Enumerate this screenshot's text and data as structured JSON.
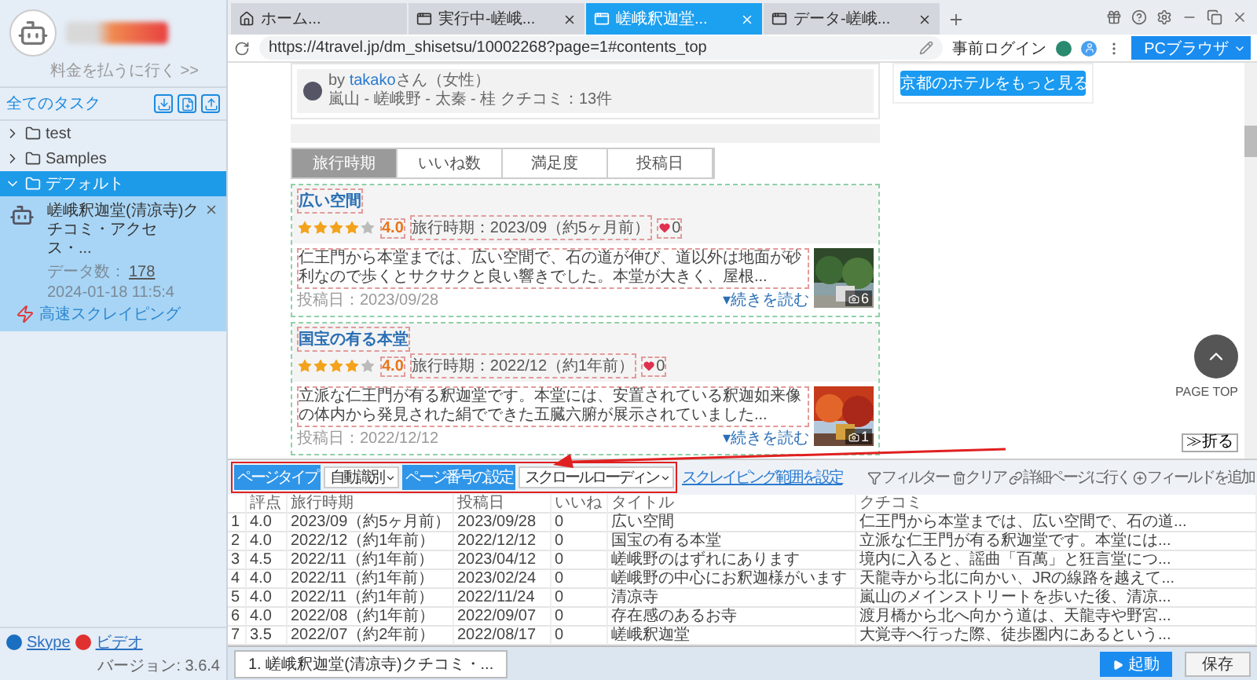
{
  "sidebar": {
    "upgrade_link": "料金を払うに行く >>",
    "section_title": "全てのタスク",
    "folders": [
      {
        "name": "test",
        "expanded": false,
        "selected": false
      },
      {
        "name": "Samples",
        "expanded": false,
        "selected": false
      },
      {
        "name": "デフォルト",
        "expanded": true,
        "selected": true,
        "children": [
          {
            "title": "嵯峨釈迦堂(清凉寺)クチコミ・アクセス・...",
            "count_label": "データ数：",
            "count": "178",
            "time": "2024-01-18 11:5:4",
            "mode": "高速スクレイピング",
            "selected": true
          }
        ]
      }
    ],
    "footer": {
      "links": [
        "Skype",
        "ビデオ"
      ],
      "version": "バージョン: 3.6.4"
    }
  },
  "browser_tabs": [
    {
      "label": "ホーム...",
      "kind": "home",
      "selected": false,
      "closable": false
    },
    {
      "label": "実行中-嵯峨...",
      "kind": "page",
      "selected": false,
      "closable": true
    },
    {
      "label": "嵯峨釈迦堂...",
      "kind": "page",
      "selected": true,
      "closable": true
    },
    {
      "label": "データ-嵯峨...",
      "kind": "page",
      "selected": false,
      "closable": true
    }
  ],
  "address_bar": {
    "url": "https://4travel.jp/dm_shisetsu/10002268?page=1#contents_top",
    "login": "事前ログイン",
    "mode_button": "PCブラウザ"
  },
  "web_page": {
    "author": {
      "by": "by ",
      "name": "takako",
      "suffix": "さん（女性）",
      "meta": "嵐山 - 嵯峨野 - 太秦 - 桂 クチコミ：13件"
    },
    "hotel_button": "京都のホテルをもっと見る",
    "sort_tabs": [
      {
        "label": "旅行時期",
        "selected": true
      },
      {
        "label": "いいね数",
        "selected": false
      },
      {
        "label": "満足度",
        "selected": false
      },
      {
        "label": "投稿日",
        "selected": false
      }
    ],
    "reviews": [
      {
        "title": "広い空間",
        "stars": 4,
        "score": "4.0",
        "period": "旅行時期：2023/09（約5ヶ月前）",
        "likes": "0",
        "text": "仁王門から本堂までは、広い空間で、石の道が伸び、道以外は地面が砂利なので歩くとサクサクと良い響きでした。本堂が大きく、屋根...",
        "more": "▾続きを読む",
        "posted": "投稿日：2023/09/28",
        "photos": "6"
      },
      {
        "title": "国宝の有る本堂",
        "stars": 4,
        "score": "4.0",
        "period": "旅行時期：2022/12（約1年前）",
        "likes": "0",
        "text": "立派な仁王門が有る釈迦堂です。本堂には、安置されている釈迦如来像の体内から発見された絹でできた五臓六腑が展示されていました...",
        "more": "▾続きを読む",
        "posted": "投稿日：2022/12/12",
        "photos": "1"
      }
    ],
    "page_top": "PAGE TOP",
    "fold_button": "≫折る"
  },
  "toolbar": {
    "page_type_label": "ページタイプ",
    "page_type_value": "自動識別",
    "page_number_label": "ページ番号の設定",
    "page_number_value": "スクロールローディン",
    "range_link": "スクレイピング範囲を設定",
    "actions": [
      {
        "label": "フィルター",
        "kind": "filter"
      },
      {
        "label": "クリア",
        "kind": "clear"
      },
      {
        "label": "詳細ページに行く",
        "kind": "link"
      },
      {
        "label": "フィールドを追加",
        "kind": "add"
      }
    ]
  },
  "table": {
    "columns": [
      "",
      "評点",
      "旅行時期",
      "投稿日",
      "いいね",
      "タイトル",
      "クチコミ"
    ],
    "rows": [
      [
        "1",
        "4.0",
        "2023/09（約5ヶ月前）",
        "2023/09/28",
        "0",
        "広い空間",
        "仁王門から本堂までは、広い空間で、石の道..."
      ],
      [
        "2",
        "4.0",
        "2022/12（約1年前）",
        "2022/12/12",
        "0",
        "国宝の有る本堂",
        "立派な仁王門が有る釈迦堂です。本堂には..."
      ],
      [
        "3",
        "4.5",
        "2022/11（約1年前）",
        "2023/04/12",
        "0",
        "嵯峨野のはずれにあります",
        "境内に入ると、謡曲「百萬」と狂言堂につ..."
      ],
      [
        "4",
        "4.0",
        "2022/11（約1年前）",
        "2023/02/24",
        "0",
        "嵯峨野の中心にお釈迦様がいます",
        "天龍寺から北に向かい、JRの線路を越えて..."
      ],
      [
        "5",
        "4.0",
        "2022/11（約1年前）",
        "2022/11/24",
        "0",
        "清凉寺",
        "嵐山のメインストリートを歩いた後、清凉..."
      ],
      [
        "6",
        "4.0",
        "2022/08（約1年前）",
        "2022/09/07",
        "0",
        "存在感のあるお寺",
        "渡月橋から北へ向かう道は、天龍寺や野宮..."
      ],
      [
        "7",
        "3.5",
        "2022/07（約2年前）",
        "2022/08/17",
        "0",
        "嵯峨釈迦堂",
        "大覚寺へ行った際、徒歩圏内にあるという..."
      ]
    ]
  },
  "bottom_bar": {
    "task_tabs": [
      {
        "label": "1. 嵯峨釈迦堂(清凉寺)クチコミ・...",
        "selected": true
      }
    ],
    "start_button": "起動",
    "save_button": "保存"
  }
}
